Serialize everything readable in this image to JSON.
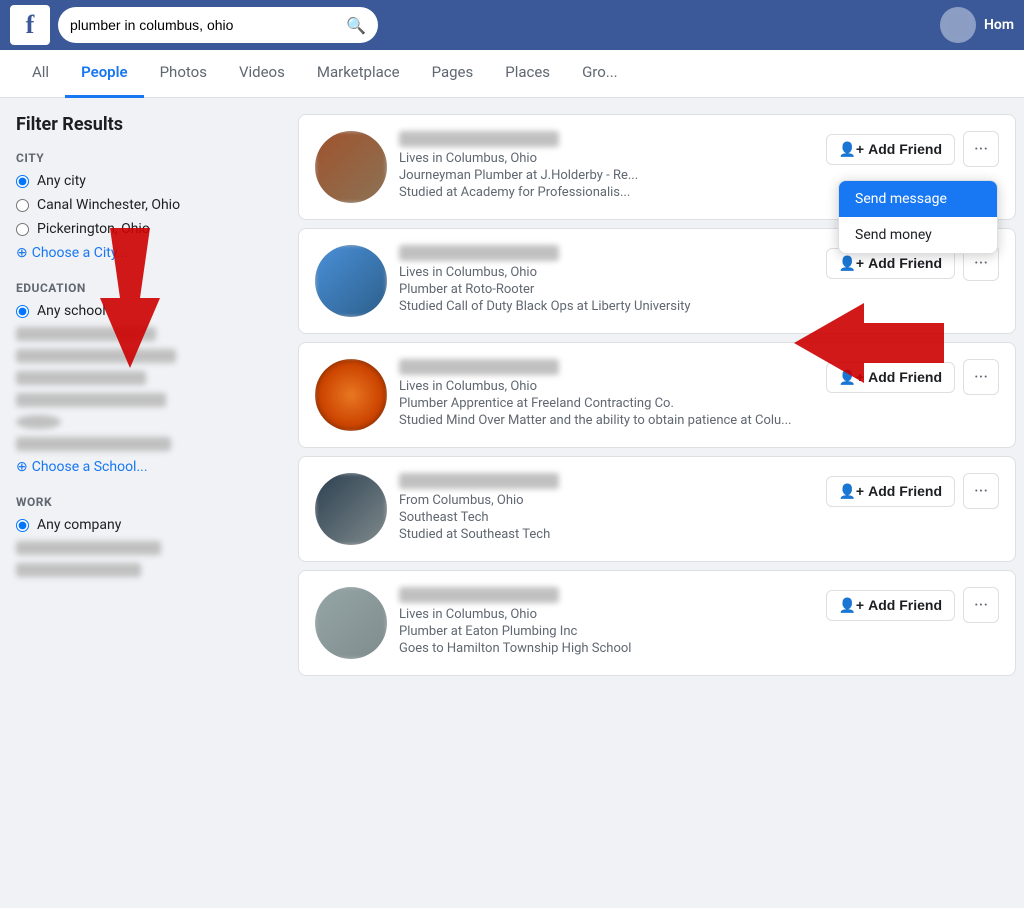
{
  "header": {
    "logo": "f",
    "search_value": "plumber in columbus, ohio",
    "search_placeholder": "plumber in columbus, ohio",
    "user_name": "Hom"
  },
  "nav": {
    "tabs": [
      {
        "label": "All",
        "active": false
      },
      {
        "label": "People",
        "active": true
      },
      {
        "label": "Photos",
        "active": false
      },
      {
        "label": "Videos",
        "active": false
      },
      {
        "label": "Marketplace",
        "active": false
      },
      {
        "label": "Pages",
        "active": false
      },
      {
        "label": "Places",
        "active": false
      },
      {
        "label": "Gro...",
        "active": false
      }
    ]
  },
  "sidebar": {
    "title": "Filter Results",
    "city_section": {
      "title": "CITY",
      "options": [
        {
          "label": "Any city",
          "checked": true
        },
        {
          "label": "Canal Winchester, Ohio",
          "checked": false
        },
        {
          "label": "Pickerington, Ohio",
          "checked": false
        }
      ],
      "choose_link": "Choose a City..."
    },
    "education_section": {
      "title": "EDUCATION",
      "options": [
        {
          "label": "Any school",
          "checked": true
        }
      ],
      "choose_link": "Choose a School..."
    },
    "work_section": {
      "title": "WORK",
      "options": [
        {
          "label": "Any company",
          "checked": true
        }
      ]
    }
  },
  "results": [
    {
      "id": 1,
      "name_blurred": true,
      "detail1": "Lives in Columbus, Ohio",
      "detail2": "Journeyman Plumber at J.Holderby - Re...",
      "detail3": "Studied at Academy for Professionalis...",
      "show_dropdown": true
    },
    {
      "id": 2,
      "name_blurred": true,
      "detail1": "Lives in Columbus, Ohio",
      "detail2": "Plumber at Roto-Rooter",
      "detail3": "Studied Call of Duty Black Ops at Liberty University",
      "show_dropdown": false
    },
    {
      "id": 3,
      "name_blurred": true,
      "detail1": "Lives in Columbus, Ohio",
      "detail2": "Plumber Apprentice at Freeland Contracting Co.",
      "detail3": "Studied Mind Over Matter and the ability to obtain patience at Colu...",
      "show_dropdown": false
    },
    {
      "id": 4,
      "name_blurred": true,
      "detail1": "From Columbus, Ohio",
      "detail2": "Southeast Tech",
      "detail3": "Studied at Southeast Tech",
      "show_dropdown": false
    },
    {
      "id": 5,
      "name_blurred": true,
      "detail1": "Lives in Columbus, Ohio",
      "detail2": "Plumber at Eaton Plumbing Inc",
      "detail3": "Goes to Hamilton Township High School",
      "show_dropdown": false
    }
  ],
  "dropdown": {
    "send_message": "Send message",
    "send_money": "Send money"
  },
  "buttons": {
    "add_friend": "Add Friend"
  }
}
